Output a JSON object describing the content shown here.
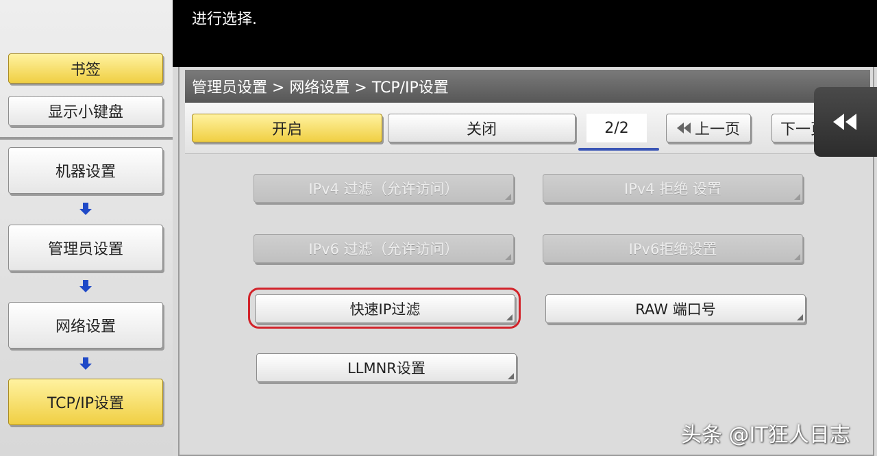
{
  "top_message": "进行选择.",
  "left_panel": {
    "bookmark": "书签",
    "show_keypad": "显示小键盘",
    "nav": [
      "机器设置",
      "管理员设置",
      "网络设置",
      "TCP/IP设置"
    ]
  },
  "breadcrumb": "管理员设置 > 网络设置 > TCP/IP设置",
  "toggle": {
    "on": "开启",
    "off": "关闭"
  },
  "pagination": {
    "page": "2/2",
    "prev": "上一页",
    "next": "下一页"
  },
  "functions": {
    "ipv4_filter_allow": "IPv4 过滤（允许访问）",
    "ipv4_deny": "IPv4 拒绝 设置",
    "ipv6_filter_allow": "IPv6 过滤（允许访问）",
    "ipv6_deny": "IPv6拒绝设置",
    "quick_ip_filter": "快速IP过滤",
    "raw_port": "RAW 端口号",
    "llmnr": "LLMNR设置"
  },
  "watermark": "头条 @IT狂人日志",
  "colors": {
    "active_yellow": "#f0cf43",
    "highlight_red": "#d2232a",
    "page_underline": "#3a55b5"
  }
}
